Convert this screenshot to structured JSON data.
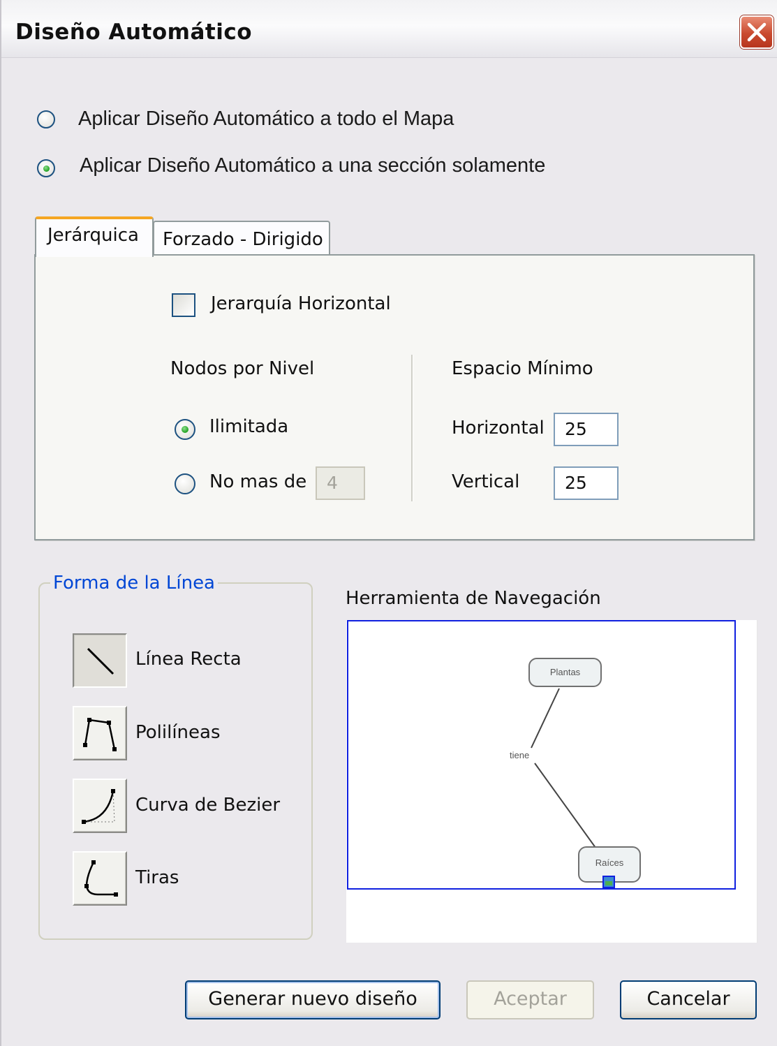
{
  "window": {
    "title": "Diseño Automático"
  },
  "scope": {
    "options": [
      {
        "label": "Aplicar Diseño Automático a todo el Mapa",
        "selected": false
      },
      {
        "label": "Aplicar Diseño Automático a una sección solamente",
        "selected": true
      }
    ]
  },
  "tabs": [
    {
      "label": "Jerárquica",
      "active": true
    },
    {
      "label": "Forzado  - Dirigido",
      "active": false
    }
  ],
  "hierarchy": {
    "horizontal_checkbox": {
      "label": "Jerarquía Horizontal",
      "checked": false
    },
    "nodes_per_level": {
      "heading": "Nodos por Nivel",
      "unlimited_label": "Ilimitada",
      "limit_label": "No mas de",
      "limit_value": "4",
      "selected": "unlimited"
    },
    "min_space": {
      "heading": "Espacio Mínimo",
      "horizontal_label": "Horizontal",
      "horizontal_value": "25",
      "vertical_label": "Vertical",
      "vertical_value": "25"
    }
  },
  "line_shape": {
    "heading": "Forma de la Línea",
    "options": [
      {
        "label": "Línea Recta",
        "icon": "straight-line-icon",
        "selected": true
      },
      {
        "label": "Polilíneas",
        "icon": "polyline-icon",
        "selected": false
      },
      {
        "label": "Curva de Bezier",
        "icon": "bezier-curve-icon",
        "selected": false
      },
      {
        "label": "Tiras",
        "icon": "strips-icon",
        "selected": false
      }
    ]
  },
  "navigator": {
    "heading": "Herramienta de Navegación",
    "nodes": [
      "Plantas",
      "Raíces"
    ],
    "link_label": "tiene"
  },
  "buttons": {
    "generate": "Generar nuevo diseño",
    "accept": "Aceptar",
    "cancel": "Cancelar"
  }
}
